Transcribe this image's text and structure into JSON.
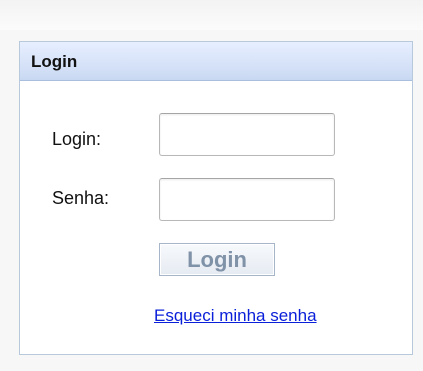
{
  "panel": {
    "title": "Login"
  },
  "form": {
    "login_label": "Login:",
    "login_value": "",
    "senha_label": "Senha:",
    "senha_value": "",
    "submit_label": "Login",
    "forgot_link": "Esqueci minha senha"
  },
  "colors": {
    "header_bg": "#d6e2f8",
    "panel_border": "#b9c9dc",
    "button_text": "#8092a8",
    "link": "#0a1fd9"
  }
}
